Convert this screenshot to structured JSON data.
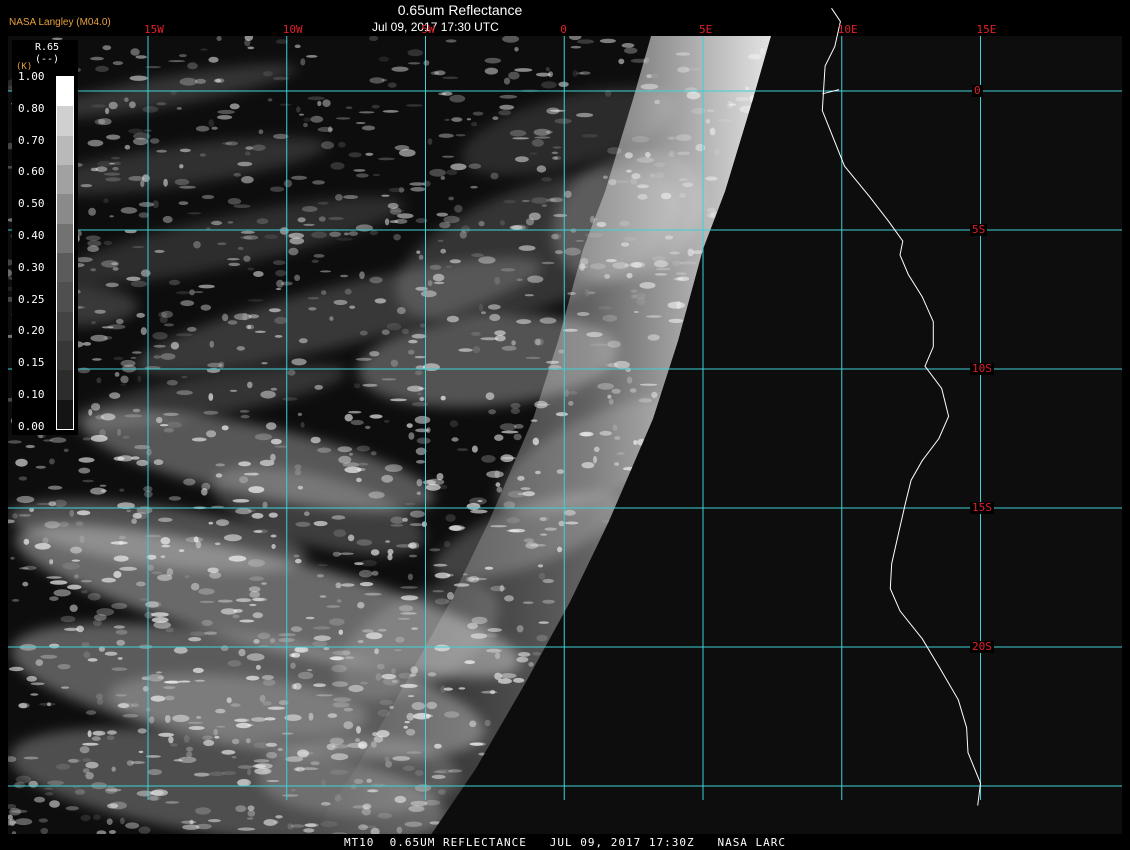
{
  "header": {
    "title": "0.65um Reflectance",
    "datetime": "Jul 09, 2017 17:30 UTC",
    "brand": "NASA Langley (M04.0)"
  },
  "footer": {
    "caption": "MT10  0.65UM REFLECTANCE   JUL 09, 2017 17:30Z   NASA LARC"
  },
  "legend": {
    "title": "R.65",
    "units": "(--)",
    "marker": "(K)",
    "ticks": [
      "1.00",
      "0.80",
      "0.70",
      "0.60",
      "0.50",
      "0.40",
      "0.30",
      "0.25",
      "0.20",
      "0.15",
      "0.10",
      "0.00"
    ],
    "swatch_levels": [
      1.0,
      0.8,
      0.7,
      0.6,
      0.5,
      0.4,
      0.3,
      0.25,
      0.2,
      0.15,
      0.1,
      0.0
    ]
  },
  "map": {
    "longitude_labels": [
      "15W",
      "10W",
      "5W",
      "0",
      "5E",
      "10E",
      "15E"
    ],
    "latitude_labels": [
      "0",
      "5S",
      "10S",
      "15S",
      "20S"
    ],
    "longitude_values": [
      -15,
      -10,
      -5,
      0,
      5,
      10,
      15
    ],
    "latitude_values": [
      0,
      -5,
      -10,
      -15,
      -20
    ],
    "grid_color": "#3fd0d8",
    "label_color": "#e0202a",
    "coast_color": "#ffffff",
    "brand_color": "#e8a23c",
    "coastline": [
      [
        9.63,
        2.98
      ],
      [
        9.95,
        2.5
      ],
      [
        9.75,
        1.6
      ],
      [
        9.4,
        0.9
      ],
      [
        9.35,
        0.1
      ],
      [
        9.3,
        -0.7
      ],
      [
        9.7,
        -1.7
      ],
      [
        10.1,
        -2.7
      ],
      [
        11.0,
        -3.8
      ],
      [
        11.7,
        -4.7
      ],
      [
        12.2,
        -5.4
      ],
      [
        12.1,
        -5.9
      ],
      [
        12.4,
        -6.6
      ],
      [
        12.9,
        -7.4
      ],
      [
        13.3,
        -8.3
      ],
      [
        13.3,
        -9.2
      ],
      [
        13.0,
        -9.9
      ],
      [
        13.6,
        -10.7
      ],
      [
        13.85,
        -11.7
      ],
      [
        13.5,
        -12.5
      ],
      [
        12.9,
        -13.3
      ],
      [
        12.5,
        -14.0
      ],
      [
        12.3,
        -14.8
      ],
      [
        12.05,
        -15.9
      ],
      [
        11.8,
        -17.0
      ],
      [
        11.75,
        -17.9
      ],
      [
        12.1,
        -18.7
      ],
      [
        12.9,
        -19.7
      ],
      [
        13.5,
        -20.7
      ],
      [
        14.2,
        -21.9
      ],
      [
        14.5,
        -22.9
      ],
      [
        14.55,
        -23.8
      ],
      [
        15.0,
        -24.9
      ],
      [
        14.9,
        -25.7
      ]
    ],
    "extra_coast": [
      [
        9.3,
        -0.1
      ],
      [
        9.9,
        0.05
      ]
    ],
    "terminator": [
      [
        7.6,
        2.5
      ],
      [
        6.8,
        -0.3
      ],
      [
        5.8,
        -3.6
      ],
      [
        5.0,
        -5.7
      ],
      [
        4.1,
        -9.0
      ],
      [
        3.2,
        -11.8
      ],
      [
        1.6,
        -15.5
      ],
      [
        0.2,
        -18.4
      ],
      [
        -1.4,
        -21.3
      ],
      [
        -3.2,
        -24.4
      ],
      [
        -4.9,
        -26.9
      ]
    ]
  }
}
